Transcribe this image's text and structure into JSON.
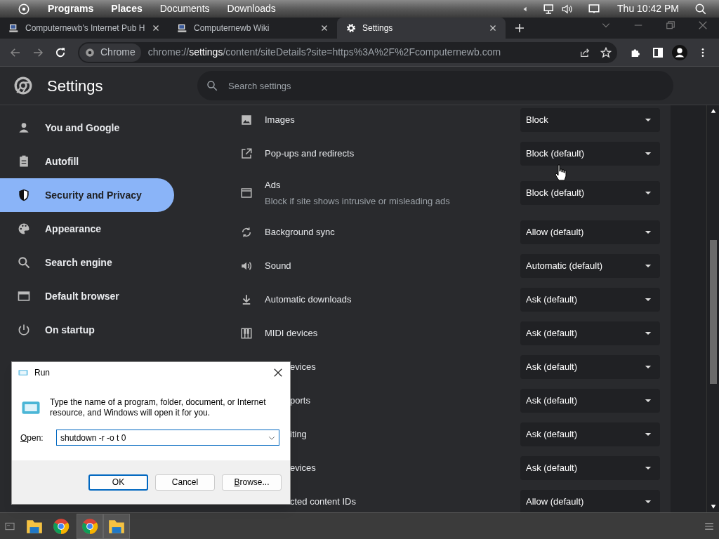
{
  "top_panel": {
    "menus": [
      "Programs",
      "Places",
      "Documents",
      "Downloads"
    ],
    "clock": "Thu 10:42 PM"
  },
  "browser": {
    "tabs": [
      {
        "title": "Computernewb's Internet Pub H",
        "selected": false
      },
      {
        "title": "Computernewb Wiki",
        "selected": false
      },
      {
        "title": "Settings",
        "selected": true
      }
    ],
    "address": {
      "chip": "Chrome",
      "url": "chrome://**settings**/content/siteDetails?site=https%3A%2F%2Fcomputernewb.com"
    }
  },
  "settings": {
    "title": "Settings",
    "search": {
      "placeholder": "Search settings"
    },
    "sidebar": [
      {
        "label": "You and Google",
        "selected": false
      },
      {
        "label": "Autofill",
        "selected": false
      },
      {
        "label": "Security and Privacy",
        "selected": true
      },
      {
        "label": "Appearance",
        "selected": false
      },
      {
        "label": "Search engine",
        "selected": false
      },
      {
        "label": "Default browser",
        "selected": false
      },
      {
        "label": "On startup",
        "selected": false
      }
    ],
    "rows": [
      {
        "label": "Images",
        "value": "Block",
        "partial": false
      },
      {
        "label": "Pop-ups and redirects",
        "value": "Block (default)",
        "partial": false
      },
      {
        "label": "Ads",
        "description": "Block if site shows intrusive or misleading ads",
        "value": "Block (default)",
        "partial": false
      },
      {
        "label": "Background sync",
        "value": "Allow (default)",
        "partial": false
      },
      {
        "label": "Sound",
        "value": "Automatic (default)",
        "partial": false
      },
      {
        "label": "Automatic downloads",
        "value": "Ask (default)",
        "partial": false
      },
      {
        "label": "MIDI devices",
        "value": "Ask (default)",
        "partial": false
      },
      {
        "label": "evices",
        "value": "Ask (default)",
        "partial": true
      },
      {
        "label": "ports",
        "value": "Ask (default)",
        "partial": true
      },
      {
        "label": "iting",
        "value": "Ask (default)",
        "partial": true
      },
      {
        "label": "evices",
        "value": "Ask (default)",
        "partial": true
      },
      {
        "label": "cted content IDs",
        "value": "Allow (default)",
        "partial": true
      }
    ]
  },
  "run_dialog": {
    "title": "Run",
    "message": "Type the name of a program, folder, document, or Internet resource, and Windows will open it for you.",
    "open_label": "Open:",
    "open_value": "shutdown -r -o t 0",
    "buttons": [
      "OK",
      "Cancel",
      "Browse..."
    ]
  },
  "taskbar": [
    {
      "kind": "folder",
      "active": false
    },
    {
      "kind": "chrome",
      "active": false
    },
    {
      "kind": "chrome",
      "active": true
    },
    {
      "kind": "folder",
      "active": true
    }
  ]
}
